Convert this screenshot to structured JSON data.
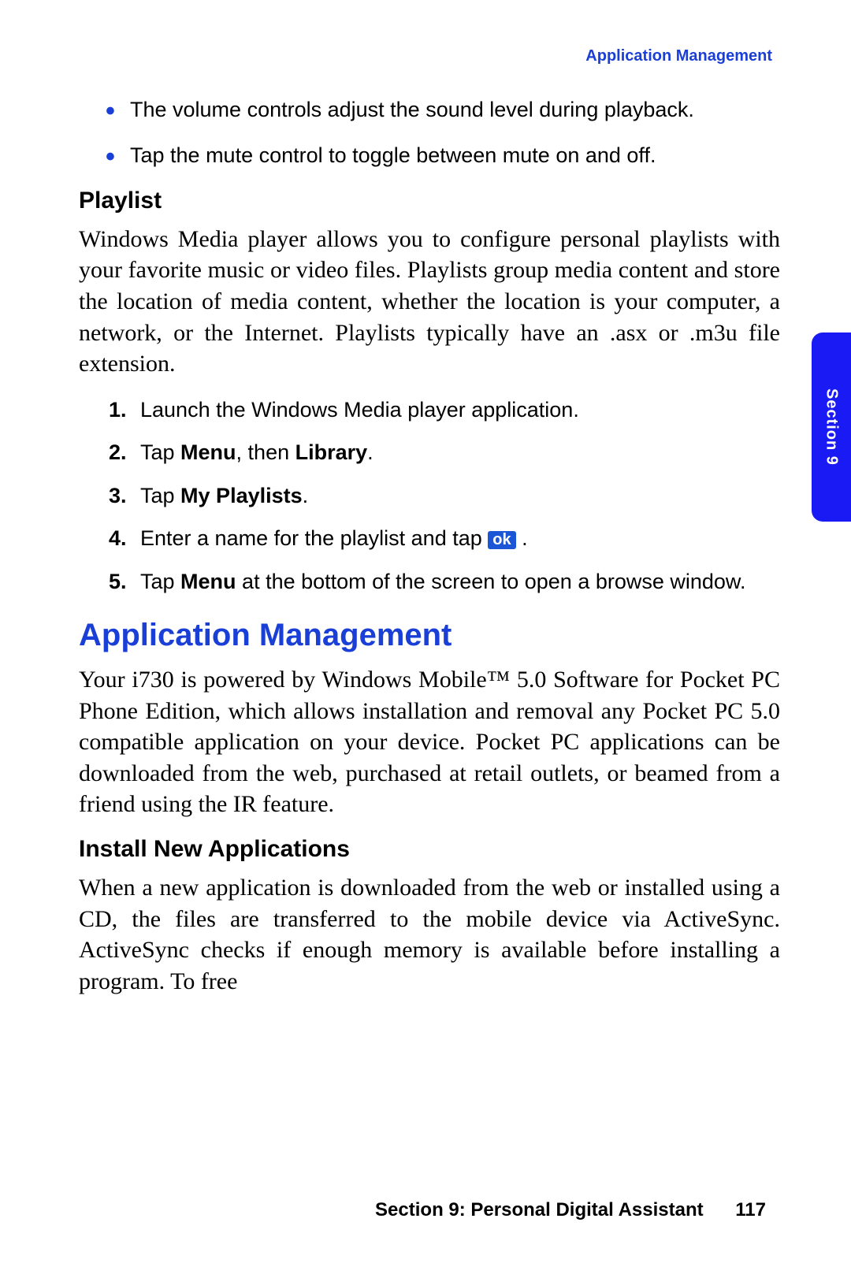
{
  "header": {
    "label": "Application Management"
  },
  "bullets": [
    "The volume controls adjust the sound level during playback.",
    "Tap the mute control to toggle between mute on and off."
  ],
  "playlist": {
    "heading": "Playlist",
    "para": "Windows Media player allows you to configure personal playlists with your favorite music or video files. Playlists group media content and store the location of media content, whether the location is your computer, a network, or the Internet. Playlists typically have an .asx or .m3u file extension.",
    "steps": {
      "s1": "Launch the Windows Media player application.",
      "s2_a": "Tap ",
      "s2_b": "Menu",
      "s2_c": ", then ",
      "s2_d": "Library",
      "s2_e": ".",
      "s3_a": "Tap ",
      "s3_b": "My Playlists",
      "s3_c": ".",
      "s4_a": "Enter a name for the playlist and tap ",
      "s4_ok": "ok",
      "s4_b": " .",
      "s5_a": "Tap ",
      "s5_b": "Menu",
      "s5_c": " at the bottom of the screen to open a browse window."
    }
  },
  "appmgmt": {
    "heading": "Application Management",
    "para": "Your i730 is powered by Windows Mobile™ 5.0 Software for Pocket PC Phone Edition, which allows installation and removal any Pocket PC 5.0 compatible application on your device. Pocket PC applications can be downloaded from the web, purchased at retail outlets, or beamed from a friend using the IR feature."
  },
  "install": {
    "heading": "Install New Applications",
    "para": "When a new application is downloaded from the web or installed using a CD, the files are transferred to the mobile device via ActiveSync. ActiveSync checks if enough memory is available before installing a program. To free"
  },
  "side_tab": "Section 9",
  "footer": {
    "section": "Section 9: Personal Digital Assistant",
    "page": "117"
  }
}
